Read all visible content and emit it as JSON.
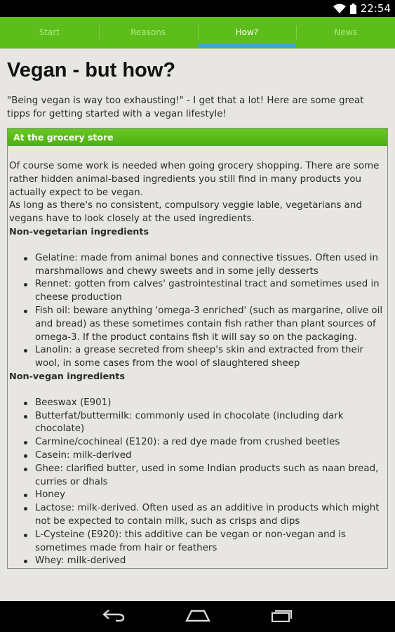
{
  "status": {
    "time": "22:54"
  },
  "tabs": [
    {
      "label": "Start",
      "active": false
    },
    {
      "label": "Reasons",
      "active": false
    },
    {
      "label": "How?",
      "active": true
    },
    {
      "label": "News",
      "active": false
    }
  ],
  "page": {
    "title": "Vegan - but how?",
    "intro": "\"Being vegan is way too exhausting!\" - I get that a lot! Here are some great tipps for getting started with a vegan lifestyle!"
  },
  "section": {
    "header": "At the grocery store",
    "paragraph1": "Of course some work is needed when going grocery shopping. There are some rather hidden animal-based ingredients you still find in many products you actually expect to be vegan.",
    "paragraph2": "As long as there's no consistent, compulsory veggie lable, vegetarians and vegans have to look closely at the used ingredients.",
    "non_veg_heading": "Non-vegetarian ingredients",
    "non_veg_items": [
      "Gelatine: made from animal bones and connective tissues. Often used in marshmallows and chewy sweets and in some jelly desserts",
      "Rennet: gotten from calves' gastrointestinal tract and sometimes used in cheese production",
      "Fish oil: beware anything 'omega-3 enriched' (such as margarine, olive oil and bread) as these sometimes contain fish rather than plant sources of omega-3. If the product contains fish it will say so on the packaging.",
      "Lanolin: a grease secreted from sheep's skin and extracted from their wool, in some cases from the wool of slaughtered sheep"
    ],
    "non_vegan_heading": "Non-vegan ingredients",
    "non_vegan_items": [
      "Beeswax (E901)",
      "Butterfat/buttermilk: commonly used in chocolate (including dark chocolate)",
      "Carmine/cochineal (E120): a red dye made from crushed beetles",
      "Casein: milk-derived",
      "Ghee: clarified butter, used in some Indian products such as naan bread, curries or dhals",
      "Honey",
      "Lactose: milk-derived. Often used as an additive in products which might not be expected to contain milk, such as crisps and dips",
      "L-Cysteine (E920): this additive can be vegan or non-vegan and is sometimes made from hair or feathers",
      "Whey: milk-derived"
    ]
  },
  "icons": {
    "wifi": "wifi-icon",
    "battery": "battery-icon",
    "back": "back-icon",
    "home": "home-icon",
    "recents": "recents-icon"
  }
}
